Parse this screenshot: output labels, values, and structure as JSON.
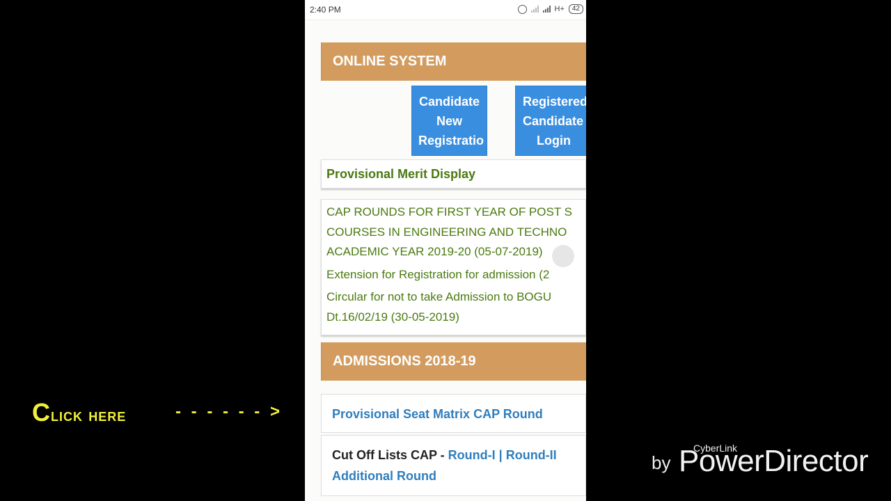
{
  "status_bar": {
    "time": "2:40 PM",
    "network": "H+",
    "battery": "42"
  },
  "online_system": {
    "title": "ONLINE SYSTEM",
    "buttons": [
      {
        "lines": [
          "Candidate",
          "New",
          "Registratio"
        ]
      },
      {
        "lines": [
          "Registered",
          "Candidate",
          "Login"
        ]
      }
    ]
  },
  "provisional_merit": "Provisional Merit Display",
  "notices": [
    {
      "lines": [
        "CAP ROUNDS FOR FIRST YEAR OF POST S",
        "COURSES IN ENGINEERING AND TECHNO",
        "ACADEMIC YEAR 2019-20 (05-07-2019)"
      ]
    },
    {
      "lines": [
        "Extension for Registration for admission (2"
      ]
    },
    {
      "lines": [
        "Circular for not to take Admission to BOGU",
        "Dt.16/02/19 (30-05-2019)"
      ]
    }
  ],
  "admissions": {
    "title": "ADMISSIONS 2018-19",
    "seat_matrix": "Provisional Seat Matrix CAP Round",
    "cutoff_prefix": "Cut Off Lists CAP - ",
    "cutoff_round1": "Round-I",
    "cutoff_sep": " | ",
    "cutoff_round2": "Round-II",
    "cutoff_additional": "Additional Round"
  },
  "overlay": {
    "click_first": "C",
    "click_rest": "lick here",
    "arrow": "- - - - - - >"
  },
  "watermark": {
    "small": "CyberLink",
    "by": "by",
    "brand": "PowerDirector"
  },
  "colors": {
    "section_bar": "#d39c5e",
    "button_blue": "#3a8ee0",
    "notice_green": "#4a7a10",
    "link_blue": "#2f7ebd",
    "overlay_yellow": "#f3f03a"
  }
}
